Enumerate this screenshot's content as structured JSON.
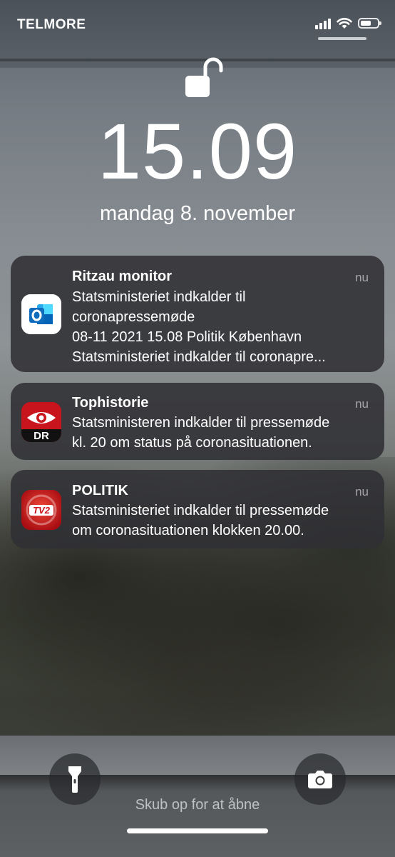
{
  "status_bar": {
    "carrier": "TELMORE",
    "signal_bars": 4,
    "wifi": true,
    "battery_level": 0.5
  },
  "lock_screen": {
    "time": "15.09",
    "date": "mandag 8. november",
    "lock_state": "unlocked"
  },
  "notifications": [
    {
      "app_icon": "outlook-icon",
      "title": "Ritzau monitor",
      "when": "nu",
      "lines": [
        "Statsministeriet indkalder til",
        "coronapressemøde",
        "08-11 2021 15.08 Politik København",
        "Statsministeriet indkalder til coronapre..."
      ]
    },
    {
      "app_icon": "dr-icon",
      "title": "Tophistorie",
      "when": "nu",
      "lines": [
        "Statsministeren indkalder til pressemøde",
        "kl. 20 om status på coronasituationen."
      ]
    },
    {
      "app_icon": "tv2-icon",
      "title": "POLITIK",
      "when": "nu",
      "lines": [
        "Statsministeriet indkalder til pressemøde",
        "om coronasituationen klokken 20.00."
      ]
    }
  ],
  "icons": {
    "dr_label": "DR",
    "tv2_label": "TV2"
  },
  "bottom": {
    "swipe_hint": "Skub op for at åbne",
    "left_button": "flashlight-icon",
    "right_button": "camera-icon"
  }
}
